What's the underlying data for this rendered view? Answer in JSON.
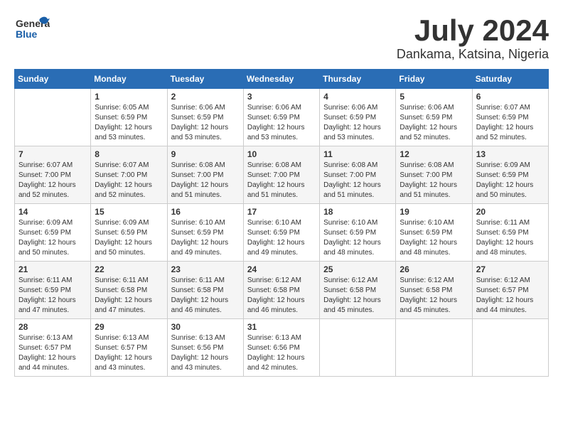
{
  "header": {
    "logo_line1": "General",
    "logo_line2": "Blue",
    "month_year": "July 2024",
    "location": "Dankama, Katsina, Nigeria"
  },
  "days_of_week": [
    "Sunday",
    "Monday",
    "Tuesday",
    "Wednesday",
    "Thursday",
    "Friday",
    "Saturday"
  ],
  "weeks": [
    [
      {
        "day": "",
        "sunrise": "",
        "sunset": "",
        "daylight": ""
      },
      {
        "day": "1",
        "sunrise": "Sunrise: 6:05 AM",
        "sunset": "Sunset: 6:59 PM",
        "daylight": "Daylight: 12 hours and 53 minutes."
      },
      {
        "day": "2",
        "sunrise": "Sunrise: 6:06 AM",
        "sunset": "Sunset: 6:59 PM",
        "daylight": "Daylight: 12 hours and 53 minutes."
      },
      {
        "day": "3",
        "sunrise": "Sunrise: 6:06 AM",
        "sunset": "Sunset: 6:59 PM",
        "daylight": "Daylight: 12 hours and 53 minutes."
      },
      {
        "day": "4",
        "sunrise": "Sunrise: 6:06 AM",
        "sunset": "Sunset: 6:59 PM",
        "daylight": "Daylight: 12 hours and 53 minutes."
      },
      {
        "day": "5",
        "sunrise": "Sunrise: 6:06 AM",
        "sunset": "Sunset: 6:59 PM",
        "daylight": "Daylight: 12 hours and 52 minutes."
      },
      {
        "day": "6",
        "sunrise": "Sunrise: 6:07 AM",
        "sunset": "Sunset: 6:59 PM",
        "daylight": "Daylight: 12 hours and 52 minutes."
      }
    ],
    [
      {
        "day": "7",
        "sunrise": "Sunrise: 6:07 AM",
        "sunset": "Sunset: 7:00 PM",
        "daylight": "Daylight: 12 hours and 52 minutes."
      },
      {
        "day": "8",
        "sunrise": "Sunrise: 6:07 AM",
        "sunset": "Sunset: 7:00 PM",
        "daylight": "Daylight: 12 hours and 52 minutes."
      },
      {
        "day": "9",
        "sunrise": "Sunrise: 6:08 AM",
        "sunset": "Sunset: 7:00 PM",
        "daylight": "Daylight: 12 hours and 51 minutes."
      },
      {
        "day": "10",
        "sunrise": "Sunrise: 6:08 AM",
        "sunset": "Sunset: 7:00 PM",
        "daylight": "Daylight: 12 hours and 51 minutes."
      },
      {
        "day": "11",
        "sunrise": "Sunrise: 6:08 AM",
        "sunset": "Sunset: 7:00 PM",
        "daylight": "Daylight: 12 hours and 51 minutes."
      },
      {
        "day": "12",
        "sunrise": "Sunrise: 6:08 AM",
        "sunset": "Sunset: 7:00 PM",
        "daylight": "Daylight: 12 hours and 51 minutes."
      },
      {
        "day": "13",
        "sunrise": "Sunrise: 6:09 AM",
        "sunset": "Sunset: 6:59 PM",
        "daylight": "Daylight: 12 hours and 50 minutes."
      }
    ],
    [
      {
        "day": "14",
        "sunrise": "Sunrise: 6:09 AM",
        "sunset": "Sunset: 6:59 PM",
        "daylight": "Daylight: 12 hours and 50 minutes."
      },
      {
        "day": "15",
        "sunrise": "Sunrise: 6:09 AM",
        "sunset": "Sunset: 6:59 PM",
        "daylight": "Daylight: 12 hours and 50 minutes."
      },
      {
        "day": "16",
        "sunrise": "Sunrise: 6:10 AM",
        "sunset": "Sunset: 6:59 PM",
        "daylight": "Daylight: 12 hours and 49 minutes."
      },
      {
        "day": "17",
        "sunrise": "Sunrise: 6:10 AM",
        "sunset": "Sunset: 6:59 PM",
        "daylight": "Daylight: 12 hours and 49 minutes."
      },
      {
        "day": "18",
        "sunrise": "Sunrise: 6:10 AM",
        "sunset": "Sunset: 6:59 PM",
        "daylight": "Daylight: 12 hours and 48 minutes."
      },
      {
        "day": "19",
        "sunrise": "Sunrise: 6:10 AM",
        "sunset": "Sunset: 6:59 PM",
        "daylight": "Daylight: 12 hours and 48 minutes."
      },
      {
        "day": "20",
        "sunrise": "Sunrise: 6:11 AM",
        "sunset": "Sunset: 6:59 PM",
        "daylight": "Daylight: 12 hours and 48 minutes."
      }
    ],
    [
      {
        "day": "21",
        "sunrise": "Sunrise: 6:11 AM",
        "sunset": "Sunset: 6:59 PM",
        "daylight": "Daylight: 12 hours and 47 minutes."
      },
      {
        "day": "22",
        "sunrise": "Sunrise: 6:11 AM",
        "sunset": "Sunset: 6:58 PM",
        "daylight": "Daylight: 12 hours and 47 minutes."
      },
      {
        "day": "23",
        "sunrise": "Sunrise: 6:11 AM",
        "sunset": "Sunset: 6:58 PM",
        "daylight": "Daylight: 12 hours and 46 minutes."
      },
      {
        "day": "24",
        "sunrise": "Sunrise: 6:12 AM",
        "sunset": "Sunset: 6:58 PM",
        "daylight": "Daylight: 12 hours and 46 minutes."
      },
      {
        "day": "25",
        "sunrise": "Sunrise: 6:12 AM",
        "sunset": "Sunset: 6:58 PM",
        "daylight": "Daylight: 12 hours and 45 minutes."
      },
      {
        "day": "26",
        "sunrise": "Sunrise: 6:12 AM",
        "sunset": "Sunset: 6:58 PM",
        "daylight": "Daylight: 12 hours and 45 minutes."
      },
      {
        "day": "27",
        "sunrise": "Sunrise: 6:12 AM",
        "sunset": "Sunset: 6:57 PM",
        "daylight": "Daylight: 12 hours and 44 minutes."
      }
    ],
    [
      {
        "day": "28",
        "sunrise": "Sunrise: 6:13 AM",
        "sunset": "Sunset: 6:57 PM",
        "daylight": "Daylight: 12 hours and 44 minutes."
      },
      {
        "day": "29",
        "sunrise": "Sunrise: 6:13 AM",
        "sunset": "Sunset: 6:57 PM",
        "daylight": "Daylight: 12 hours and 43 minutes."
      },
      {
        "day": "30",
        "sunrise": "Sunrise: 6:13 AM",
        "sunset": "Sunset: 6:56 PM",
        "daylight": "Daylight: 12 hours and 43 minutes."
      },
      {
        "day": "31",
        "sunrise": "Sunrise: 6:13 AM",
        "sunset": "Sunset: 6:56 PM",
        "daylight": "Daylight: 12 hours and 42 minutes."
      },
      {
        "day": "",
        "sunrise": "",
        "sunset": "",
        "daylight": ""
      },
      {
        "day": "",
        "sunrise": "",
        "sunset": "",
        "daylight": ""
      },
      {
        "day": "",
        "sunrise": "",
        "sunset": "",
        "daylight": ""
      }
    ]
  ]
}
